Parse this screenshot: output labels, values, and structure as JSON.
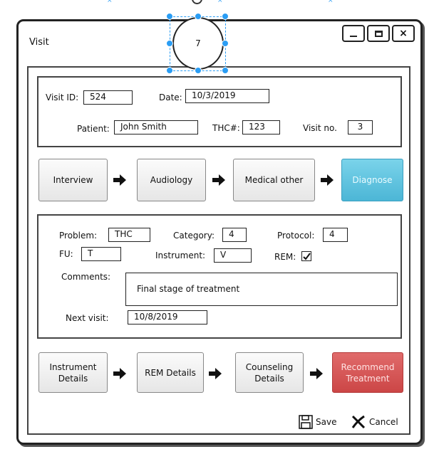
{
  "window": {
    "title": "Visit",
    "controls": {
      "minimize": "–",
      "maximize": "□",
      "close": "×"
    }
  },
  "canvas": {
    "selected_circle_label": "7"
  },
  "header_fields": {
    "visit_id": {
      "label": "Visit ID:",
      "value": "524"
    },
    "date": {
      "label": "Date:",
      "value": "10/3/2019"
    },
    "patient": {
      "label": "Patient:",
      "value": "John Smith"
    },
    "thc": {
      "label": "THC#:",
      "value": "123"
    },
    "visit_no": {
      "label": "Visit no.",
      "value": "3"
    }
  },
  "workflow_steps": [
    {
      "label": "Interview"
    },
    {
      "label": "Audiology"
    },
    {
      "label": "Medical other"
    },
    {
      "label": "Diagnose",
      "color": "#4cb6d6"
    }
  ],
  "diagnosis": {
    "problem": {
      "label": "Problem:",
      "value": "THC"
    },
    "category": {
      "label": "Category:",
      "value": "4"
    },
    "protocol": {
      "label": "Protocol:",
      "value": "4"
    },
    "fu": {
      "label": "FU:",
      "value": "T"
    },
    "instrument": {
      "label": "Instrument:",
      "value": "V"
    },
    "rem": {
      "label": "REM:",
      "checked": true
    },
    "comments": {
      "label": "Comments:",
      "value": "Final stage of treatment"
    },
    "next_visit": {
      "label": "Next visit:",
      "value": "10/8/2019"
    }
  },
  "detail_steps": [
    {
      "label": "Instrument Details"
    },
    {
      "label": "REM Details"
    },
    {
      "label": "Counseling Details"
    },
    {
      "label": "Recommend Treatment",
      "color": "#cc4646"
    }
  ],
  "footer": {
    "save": "Save",
    "cancel": "Cancel"
  }
}
